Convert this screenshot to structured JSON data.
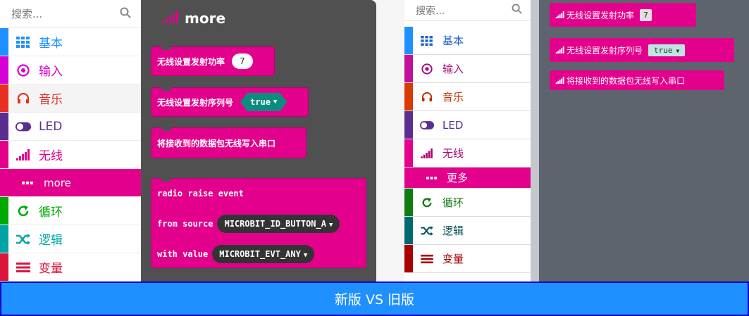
{
  "new": {
    "search_placeholder": "搜索...",
    "categories": [
      {
        "label": "基本",
        "color": "#1e90ff",
        "icon": "grid-icon"
      },
      {
        "label": "输入",
        "color": "#d400d4",
        "icon": "target-icon"
      },
      {
        "label": "音乐",
        "color": "#e63022",
        "icon": "headphones-icon"
      },
      {
        "label": "LED",
        "color": "#5c2d91",
        "icon": "toggle-icon"
      },
      {
        "label": "无线",
        "color": "#e3008c",
        "icon": "signal-icon"
      },
      {
        "label": "more",
        "color": "#e3008c",
        "icon": "dots-icon"
      },
      {
        "label": "循环",
        "color": "#00aa00",
        "icon": "refresh-icon"
      },
      {
        "label": "逻辑",
        "color": "#00a4a6",
        "icon": "shuffle-icon"
      },
      {
        "label": "变量",
        "color": "#dc143c",
        "icon": "list-icon"
      }
    ],
    "flyout_title": "more",
    "blocks": {
      "set_power": {
        "label": "无线设置发射功率",
        "value": "7"
      },
      "set_serial": {
        "label": "无线设置发射序列号",
        "value": "true"
      },
      "write_packet": {
        "label": "将接收到的数据包无线写入串口"
      },
      "raise_event": {
        "line1": "radio raise event",
        "line2": "from source",
        "source_value": "MICROBIT_ID_BUTTON_A",
        "line3": "with value",
        "value_value": "MICROBIT_EVT_ANY"
      }
    }
  },
  "old": {
    "search_placeholder": "搜索...",
    "categories": [
      {
        "label": "基本",
        "color": "#1e90ff",
        "icon": "grid-icon"
      },
      {
        "label": "输入",
        "color": "#c0119a",
        "icon": "target-icon"
      },
      {
        "label": "音乐",
        "color": "#d83b01",
        "icon": "headphones-icon"
      },
      {
        "label": "LED",
        "color": "#5c2d91",
        "icon": "toggle-icon"
      },
      {
        "label": "无线",
        "color": "#e3008c",
        "icon": "signal-icon"
      },
      {
        "label": "更多",
        "color": "#e3008c",
        "icon": "dots-icon"
      },
      {
        "label": "循环",
        "color": "#107c10",
        "icon": "refresh-icon"
      },
      {
        "label": "逻辑",
        "color": "#006970",
        "icon": "shuffle-icon"
      },
      {
        "label": "变量",
        "color": "#a80000",
        "icon": "list-icon"
      }
    ],
    "blocks": {
      "set_power": {
        "label": "无线设置发射功率",
        "value": "7"
      },
      "set_serial": {
        "label": "无线设置发射序列号",
        "value": "true"
      },
      "write_packet": {
        "label": "将接收到的数据包无线写入串口"
      }
    }
  },
  "banner": "新版 VS 旧版"
}
